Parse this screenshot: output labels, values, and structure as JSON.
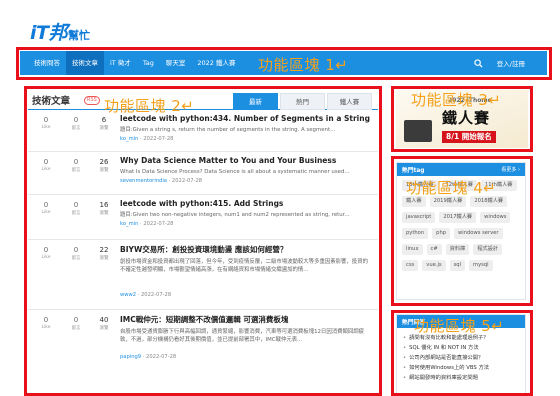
{
  "logo": {
    "main": "iT邦",
    "sub": "幫忙"
  },
  "nav": {
    "items": [
      {
        "label": "技術問答",
        "active": false
      },
      {
        "label": "技術文章",
        "active": true
      },
      {
        "label": "iT 徵才",
        "active": false
      },
      {
        "label": "Tag",
        "active": false
      },
      {
        "label": "聊天室",
        "active": false
      },
      {
        "label": "2022 鐵人賽",
        "active": false
      }
    ],
    "search_icon": "search-icon",
    "login_label": "登入/註冊"
  },
  "zones": [
    {
      "label": "功能區塊 1↵"
    },
    {
      "label": "功能區塊 2↵"
    },
    {
      "label": "功能區塊 3↵"
    },
    {
      "label": "功能區塊 4↵"
    },
    {
      "label": "功能區塊 5↵"
    }
  ],
  "main": {
    "title": "技術文章",
    "rss": "RSS",
    "tabs": [
      {
        "label": "最新",
        "active": true
      },
      {
        "label": "熱門",
        "active": false
      },
      {
        "label": "鐵人賽",
        "active": false
      }
    ],
    "stat_labels": {
      "likes": "Like",
      "replies": "留言",
      "views": "瀏覽"
    },
    "articles": [
      {
        "likes": "0",
        "replies": "0",
        "views": "6",
        "title": "leetcode with python:434. Number of Segments in a String",
        "summary": "題目:Given a string s, return the number of segments in the string. A segment...",
        "author": "ko_min",
        "date": "2022-07-28"
      },
      {
        "likes": "0",
        "replies": "0",
        "views": "26",
        "title": "Why Data Science Matter to You and Your Business",
        "summary": "What Is Data Science Process? Data Science is all about a systematic manner used...",
        "author": "sevenmentorindia",
        "date": "2022-07-28"
      },
      {
        "likes": "0",
        "replies": "0",
        "views": "16",
        "title": "leetcode with python:415. Add Strings",
        "summary": "題目:Given two non-negative integers, num1 and num2 represented as string, retur...",
        "author": "ko_min",
        "date": "2022-07-28"
      },
      {
        "likes": "0",
        "replies": "0",
        "views": "22",
        "title": "BIYW交易所：創投投資環境動盪 應該如何經營？",
        "summary": "創投市場資金和投資都出現了回落，但今年，受到疫情反覆，二級市場波動較大等多重因素影響，投資的不確定性越發明顯，市場觀望情緒高漲，在有網絡資和市場情緒交織盪加的情...",
        "author": "www2",
        "date": "2022-07-28"
      },
      {
        "likes": "0",
        "replies": "0",
        "views": "40",
        "title": "IMC戰仲元：短期調整不改價值邏輯 可選消費板塊",
        "summary": "自股市場受通貨膨脹下行與高幅回調，通貨緊縮，影響消費，汽車等可選消費板塊12日因消費類回調疲軟，不過，部分機構仍看好其後期價值，並已提前部署其中，IMC戰仲元表...",
        "author": "paping9",
        "date": "2022-07-28"
      }
    ]
  },
  "banner": {
    "small": "2022 iThome",
    "big": "鐵人賽",
    "date": "8/1 開始報名"
  },
  "tags_panel": {
    "title": "熱門tag",
    "more": "看更多 ›",
    "tags": [
      "13th鐵人賽",
      "12th鐵人賽",
      "11th鐵人賽",
      "鐵人賽",
      "2019鐵人賽",
      "2018鐵人賽",
      "javascript",
      "2017鐵人賽",
      "windows",
      "python",
      "php",
      "windows server",
      "linux",
      "c#",
      "資料庫",
      "程式設計",
      "css",
      "vue.js",
      "sql",
      "mysql"
    ]
  },
  "news_panel": {
    "title": "熱門回答",
    "items": [
      "請問有沒有比較和能處理過例子？",
      "SQL 優化 IN 和 NOT IN 方法",
      "公司內部網站是否能直接公開？",
      "如何使用Windows上的 VBS 方法",
      "網站開發時的資料庫設定問題"
    ]
  },
  "colors": {
    "brand_blue": "#1d8fe1",
    "annotation_red": "#e8101a",
    "annotation_label": "#f3a11b"
  }
}
